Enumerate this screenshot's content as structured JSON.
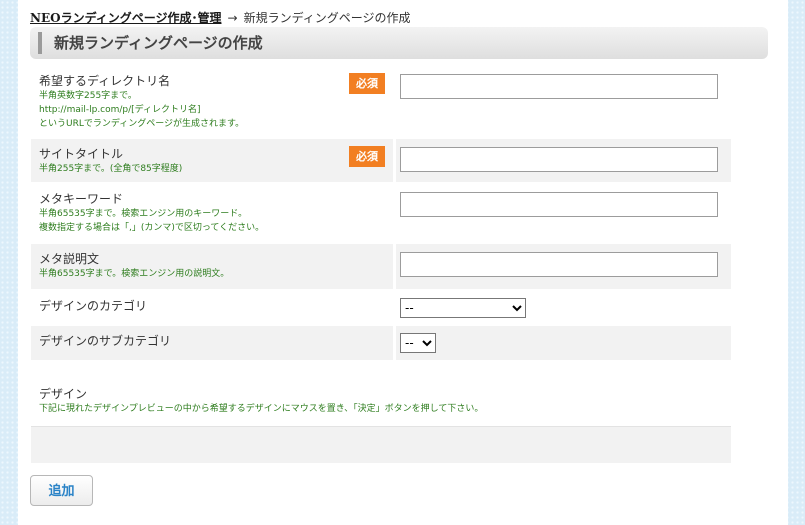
{
  "breadcrumb": {
    "link_label": "NEOランディングページ作成･管理",
    "arrow": "→",
    "current": "新規ランディングページの作成"
  },
  "page_title": "新規ランディングページの作成",
  "required_badge": "必須",
  "fields": [
    {
      "label": "希望するディレクトリ名",
      "notes": [
        "半角英数字255字まで。",
        "http://mail-lp.com/p/[ディレクトリ名]",
        "というURLでランディングページが生成されます。"
      ],
      "required": true,
      "value": ""
    },
    {
      "label": "サイトタイトル",
      "notes": [
        "半角255字まで。(全角で85字程度)"
      ],
      "required": true,
      "value": ""
    },
    {
      "label": "メタキーワード",
      "notes": [
        "半角65535字まで。検索エンジン用のキーワード。",
        "複数指定する場合は「,」(カンマ)で区切ってください。"
      ],
      "required": false,
      "value": ""
    },
    {
      "label": "メタ説明文",
      "notes": [
        "半角65535字まで。検索エンジン用の説明文。"
      ],
      "required": false,
      "value": ""
    }
  ],
  "design_category": {
    "label": "デザインのカテゴリ",
    "selected": "--"
  },
  "design_subcategory": {
    "label": "デザインのサブカテゴリ",
    "selected": "--"
  },
  "design": {
    "label": "デザイン",
    "note": "下記に現れたデザインプレビューの中から希望するデザインにマウスを置き、「決定」ボタンを押して下さい。"
  },
  "submit_label": "追加",
  "colors": {
    "required_badge": "#f27f22",
    "note_text": "#2e7d1e",
    "button_text": "#2a83c7",
    "background": "#d9ecf8"
  }
}
